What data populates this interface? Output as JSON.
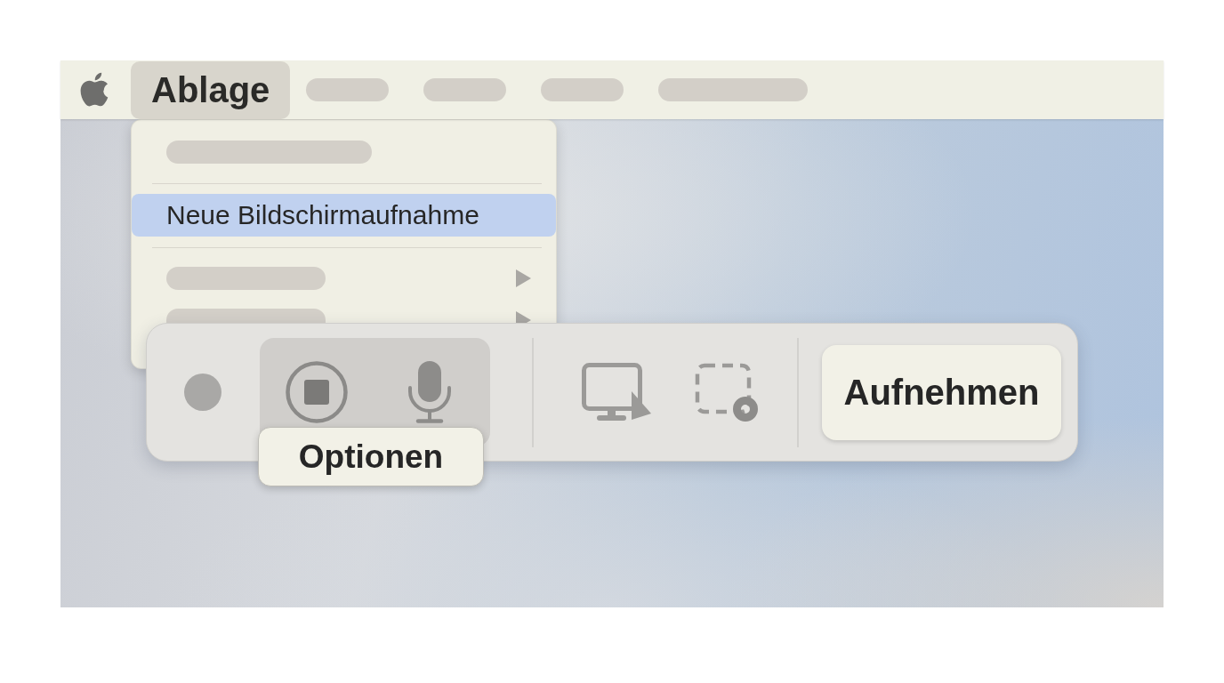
{
  "menu_bar": {
    "menus": [
      {
        "kind": "label",
        "label": "Ablage",
        "selected": true
      },
      {
        "kind": "placeholder",
        "selected": false
      },
      {
        "kind": "placeholder",
        "selected": false
      },
      {
        "kind": "placeholder",
        "selected": false
      },
      {
        "kind": "placeholder",
        "selected": false
      }
    ]
  },
  "menu": {
    "items": [
      {
        "kind": "placeholder",
        "selected": false,
        "submenu": false
      },
      {
        "kind": "separator"
      },
      {
        "kind": "label",
        "label": "Neue Bildschirmaufnahme",
        "selected": true,
        "submenu": false
      },
      {
        "kind": "separator"
      },
      {
        "kind": "placeholder",
        "selected": false,
        "submenu": true
      },
      {
        "kind": "placeholder",
        "selected": false,
        "submenu": true
      }
    ]
  },
  "capture_bar": {
    "sections": [
      {
        "groups": [
          {
            "selected": false,
            "tools": [
              {
                "kind": "dot"
              }
            ]
          },
          {
            "selected": true,
            "tools": [
              {
                "kind": "stop"
              },
              {
                "kind": "microphone"
              }
            ],
            "tooltip": "Optionen"
          }
        ]
      },
      {
        "groups": [
          {
            "selected": false,
            "tools": [
              {
                "kind": "screen"
              },
              {
                "kind": "region"
              }
            ]
          }
        ]
      }
    ],
    "record_button": {
      "label": "Aufnehmen"
    }
  }
}
